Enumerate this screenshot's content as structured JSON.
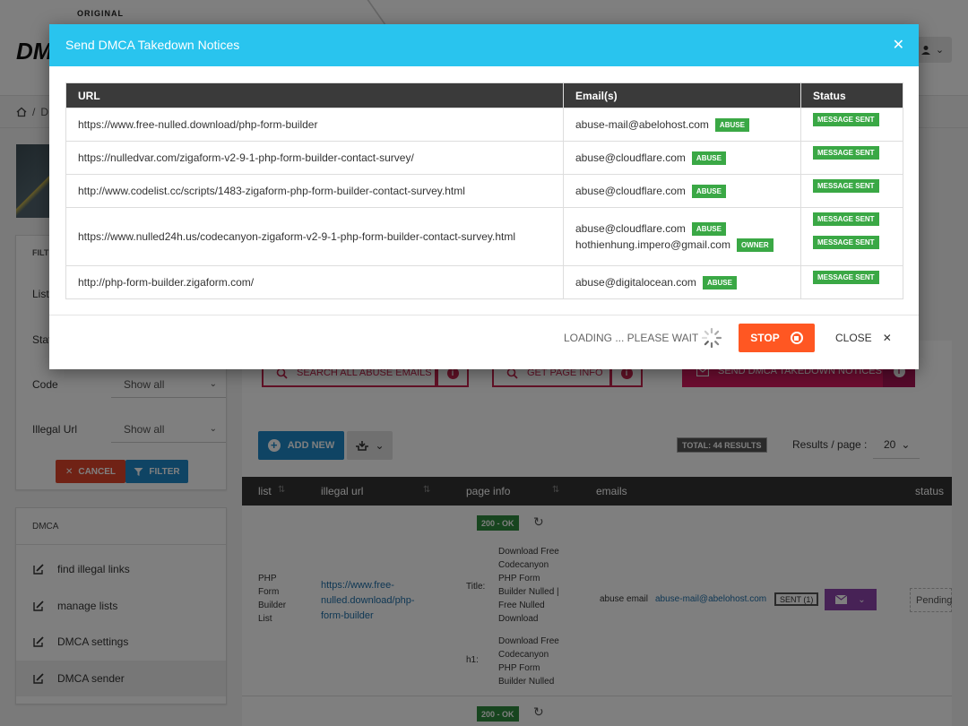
{
  "app": {
    "brand_small": "ORIGINAL",
    "brand_big": "DMCA",
    "breadcrumb_text": "D"
  },
  "filters": {
    "title": "FILT",
    "rows": [
      {
        "label": "List",
        "value": ""
      },
      {
        "label": "Stat",
        "value": ""
      },
      {
        "label": "Code",
        "value": "Show all"
      },
      {
        "label": "Illegal Url",
        "value": "Show all"
      }
    ],
    "cancel_label": "CANCEL",
    "filter_label": "FILTER"
  },
  "dmca_menu": {
    "title": "DMCA",
    "items": [
      {
        "label": "find illegal links"
      },
      {
        "label": "manage lists"
      },
      {
        "label": "DMCA settings"
      },
      {
        "label": "DMCA sender"
      }
    ]
  },
  "main": {
    "search_label": "SEARCH ALL ABUSE EMAILS",
    "page_info_label": "GET PAGE INFO",
    "send_label": "SEND DMCA TAKEDOWN NOTICES",
    "add_new_label": "ADD NEW",
    "total_label": "TOTAL: 44 RESULTS",
    "rpp_label": "Results / page :",
    "rpp_value": "20",
    "columns": [
      "list",
      "illegal url",
      "page info",
      "emails",
      "status"
    ],
    "row1": {
      "code": "200 - OK",
      "list_name": [
        "PHP",
        "Form",
        "Builder",
        "List"
      ],
      "url": [
        "https://www.free-",
        "nulled.download/php-",
        "form-builder"
      ],
      "title_label": "Title:",
      "title_text": [
        "Download Free",
        "Codecanyon",
        "PHP Form",
        "Builder Nulled |",
        "Free Nulled",
        "Download"
      ],
      "h1_label": "h1:",
      "h1_text": [
        "Download Free",
        "Codecanyon",
        "PHP Form",
        "Builder Nulled"
      ],
      "email_label": "abuse email",
      "email": "abuse-mail@abelohost.com",
      "sent": "SENT (1)",
      "status": "Pending"
    },
    "row2": {
      "code": "200 - OK"
    }
  },
  "modal": {
    "title": "Send DMCA Takedown Notices",
    "headers": {
      "url": "URL",
      "emails": "Email(s)",
      "status": "Status"
    },
    "rows": [
      {
        "url": "https://www.free-nulled.download/php-form-builder",
        "emails": [
          {
            "address": "abuse-mail@abelohost.com",
            "tag": "ABUSE"
          }
        ],
        "statuses": [
          "MESSAGE SENT"
        ]
      },
      {
        "url": "https://nulledvar.com/zigaform-v2-9-1-php-form-builder-contact-survey/",
        "emails": [
          {
            "address": "abuse@cloudflare.com",
            "tag": "ABUSE"
          }
        ],
        "statuses": [
          "MESSAGE SENT"
        ]
      },
      {
        "url": "http://www.codelist.cc/scripts/1483-zigaform-php-form-builder-contact-survey.html",
        "emails": [
          {
            "address": "abuse@cloudflare.com",
            "tag": "ABUSE"
          }
        ],
        "statuses": [
          "MESSAGE SENT"
        ]
      },
      {
        "url": "https://www.nulled24h.us/codecanyon-zigaform-v2-9-1-php-form-builder-contact-survey.html",
        "emails": [
          {
            "address": "abuse@cloudflare.com",
            "tag": "ABUSE"
          },
          {
            "address": "hothienhung.impero@gmail.com",
            "tag": "OWNER"
          }
        ],
        "statuses": [
          "MESSAGE SENT",
          "MESSAGE SENT"
        ]
      },
      {
        "url": "http://php-form-builder.zigaform.com/",
        "emails": [
          {
            "address": "abuse@digitalocean.com",
            "tag": "ABUSE"
          }
        ],
        "statuses": [
          "MESSAGE SENT"
        ]
      }
    ],
    "loading_label": "LOADING ... PLEASE WAIT",
    "stop_label": "STOP",
    "close_label": "CLOSE"
  },
  "colors": {
    "modal_header": "#29c4ee",
    "tag_green": "#3aa845",
    "stop_orange": "#ff5722",
    "primary_blue": "#1e88c8",
    "danger_pink": "#d81b60"
  }
}
